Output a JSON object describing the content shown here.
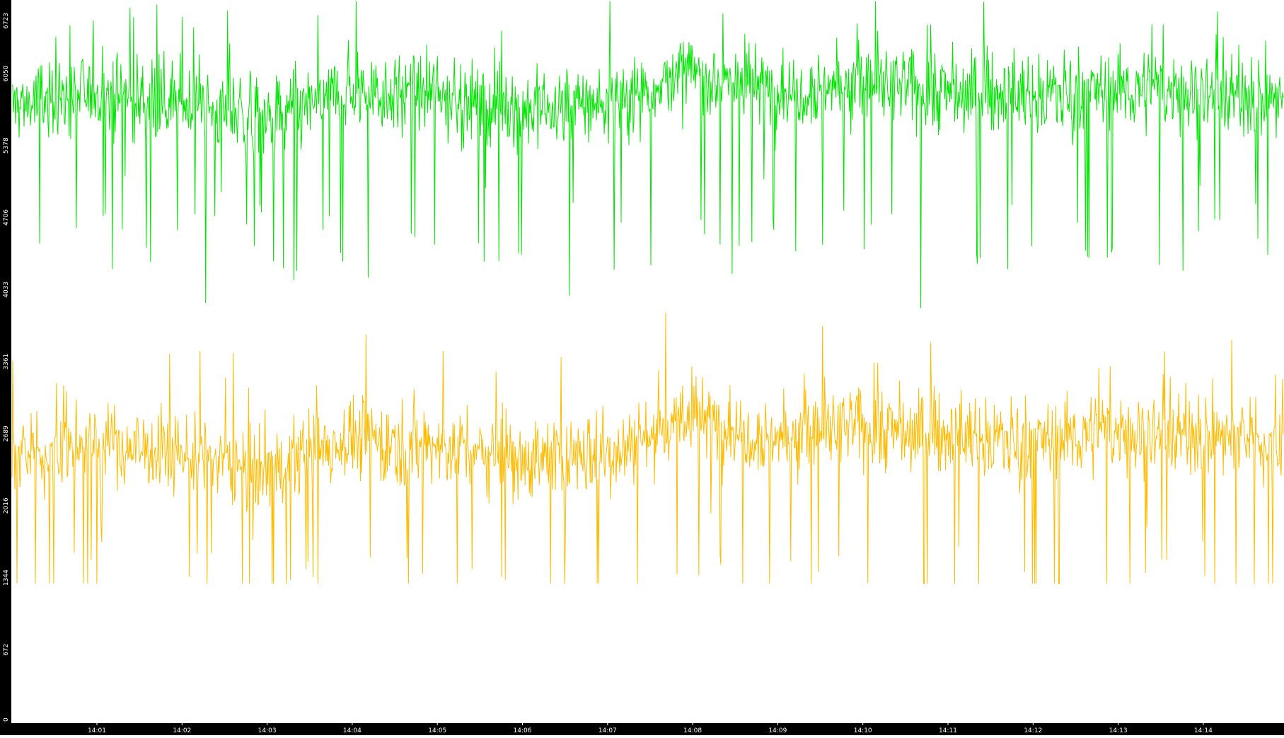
{
  "chart_data": {
    "type": "line",
    "title": "",
    "xlabel": "",
    "ylabel": "",
    "ylim": [
      0,
      6723
    ],
    "xlim_minutes": [
      14.0,
      14.0
    ],
    "x_start": "14:00:01",
    "x_end": "14:14:56",
    "y_ticks": [
      "0",
      "672",
      "1344",
      "2016",
      "2689",
      "3361",
      "4033",
      "4706",
      "5378",
      "6050",
      "6723"
    ],
    "x_ticks": [
      "14:01",
      "14:02",
      "14:03",
      "14:04",
      "14:05",
      "14:06",
      "14:07",
      "14:08",
      "14:09",
      "14:10",
      "14:11",
      "14:12",
      "14:13",
      "14:14"
    ],
    "grid": false,
    "legend": "none",
    "series": [
      {
        "color": "#00e600",
        "mean_level": [
          5750,
          5870,
          5780,
          5600,
          5900,
          5850,
          5700,
          5780,
          6050,
          5900,
          5950,
          5880,
          5850,
          5900,
          5880,
          5800
        ],
        "min": 3750,
        "max": 6723
      },
      {
        "color": "#ffbb00",
        "mean_level": [
          2450,
          2600,
          2500,
          2350,
          2650,
          2580,
          2450,
          2500,
          2850,
          2650,
          2750,
          2680,
          2620,
          2700,
          2680,
          2600
        ],
        "min": 1290,
        "max": 4150
      }
    ],
    "colors": {
      "axis_background": "#000000",
      "axis_text": "#ffffff",
      "plot_background": "#ffffff"
    }
  }
}
